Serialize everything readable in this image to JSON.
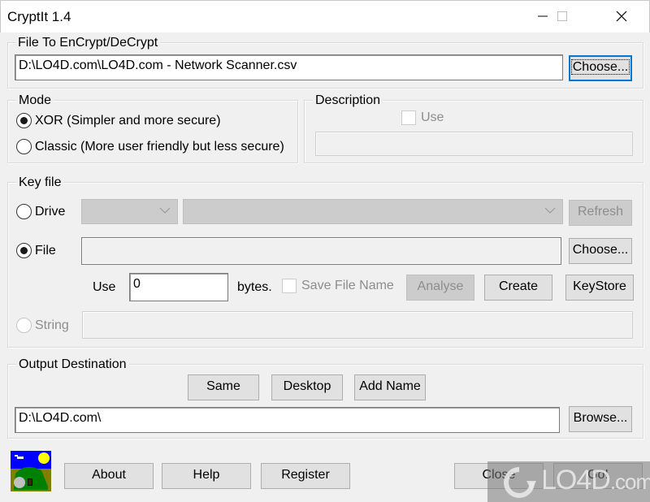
{
  "window": {
    "title": "CryptIt 1.4",
    "controls": {
      "minimize": "minimize",
      "maximize": "maximize",
      "close": "close"
    }
  },
  "file_group": {
    "label": "File To EnCrypt/DeCrypt",
    "path_value": "D:\\LO4D.com\\LO4D.com - Network Scanner.csv",
    "choose_label": "Choose..."
  },
  "mode_group": {
    "label": "Mode",
    "options": [
      {
        "label": "XOR (Simpler and more secure)",
        "selected": true
      },
      {
        "label": "Classic (More user friendly but less secure)",
        "selected": false
      }
    ]
  },
  "description_group": {
    "label": "Description",
    "use_label": "Use",
    "use_checked": false,
    "text_value": ""
  },
  "keyfile_group": {
    "label": "Key file",
    "drive_label": "Drive",
    "drive_selected": false,
    "drive_value": "",
    "folder_value": "",
    "refresh_label": "Refresh",
    "file_label": "File",
    "file_selected": true,
    "file_value": "",
    "file_choose_label": "Choose...",
    "use_label": "Use",
    "use_bytes_value": "0",
    "bytes_label": "bytes.",
    "save_file_name_label": "Save File Name",
    "save_file_name_checked": false,
    "analyse_label": "Analyse",
    "create_label": "Create",
    "keystore_label": "KeyStore",
    "string_label": "String",
    "string_selected": false,
    "string_value": ""
  },
  "output_group": {
    "label": "Output Destination",
    "same_label": "Same",
    "desktop_label": "Desktop",
    "add_name_label": "Add Name",
    "path_value": "D:\\LO4D.com\\",
    "browse_label": "Browse..."
  },
  "footer": {
    "about_label": "About",
    "help_label": "Help",
    "register_label": "Register",
    "close_label": "Close",
    "go_label": "Go!"
  },
  "watermark": {
    "brand": "LO4D",
    "suffix": ".com"
  }
}
